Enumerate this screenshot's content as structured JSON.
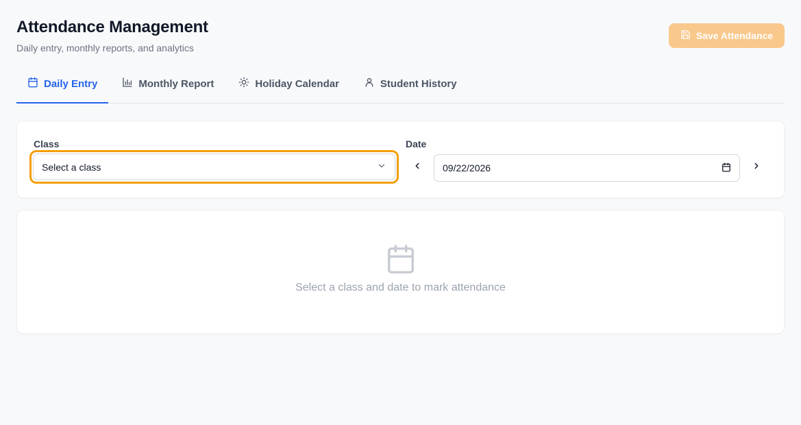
{
  "header": {
    "title": "Attendance Management",
    "subtitle": "Daily entry, monthly reports, and analytics",
    "save_label": "Save Attendance"
  },
  "tabs": [
    {
      "label": "Daily Entry",
      "icon": "calendar-icon",
      "active": true
    },
    {
      "label": "Monthly Report",
      "icon": "bar-chart-icon",
      "active": false
    },
    {
      "label": "Holiday Calendar",
      "icon": "sun-icon",
      "active": false
    },
    {
      "label": "Student History",
      "icon": "user-icon",
      "active": false
    }
  ],
  "filters": {
    "class_label": "Class",
    "class_value": "Select a class",
    "date_label": "Date",
    "date_value": "09/22/2026"
  },
  "empty_state": {
    "icon": "calendar-icon",
    "message": "Select a class and date to mark attendance"
  },
  "colors": {
    "accent": "#2563eb",
    "save_button_disabled": "#f9c88b",
    "focus_ring": "#f59e0b"
  }
}
